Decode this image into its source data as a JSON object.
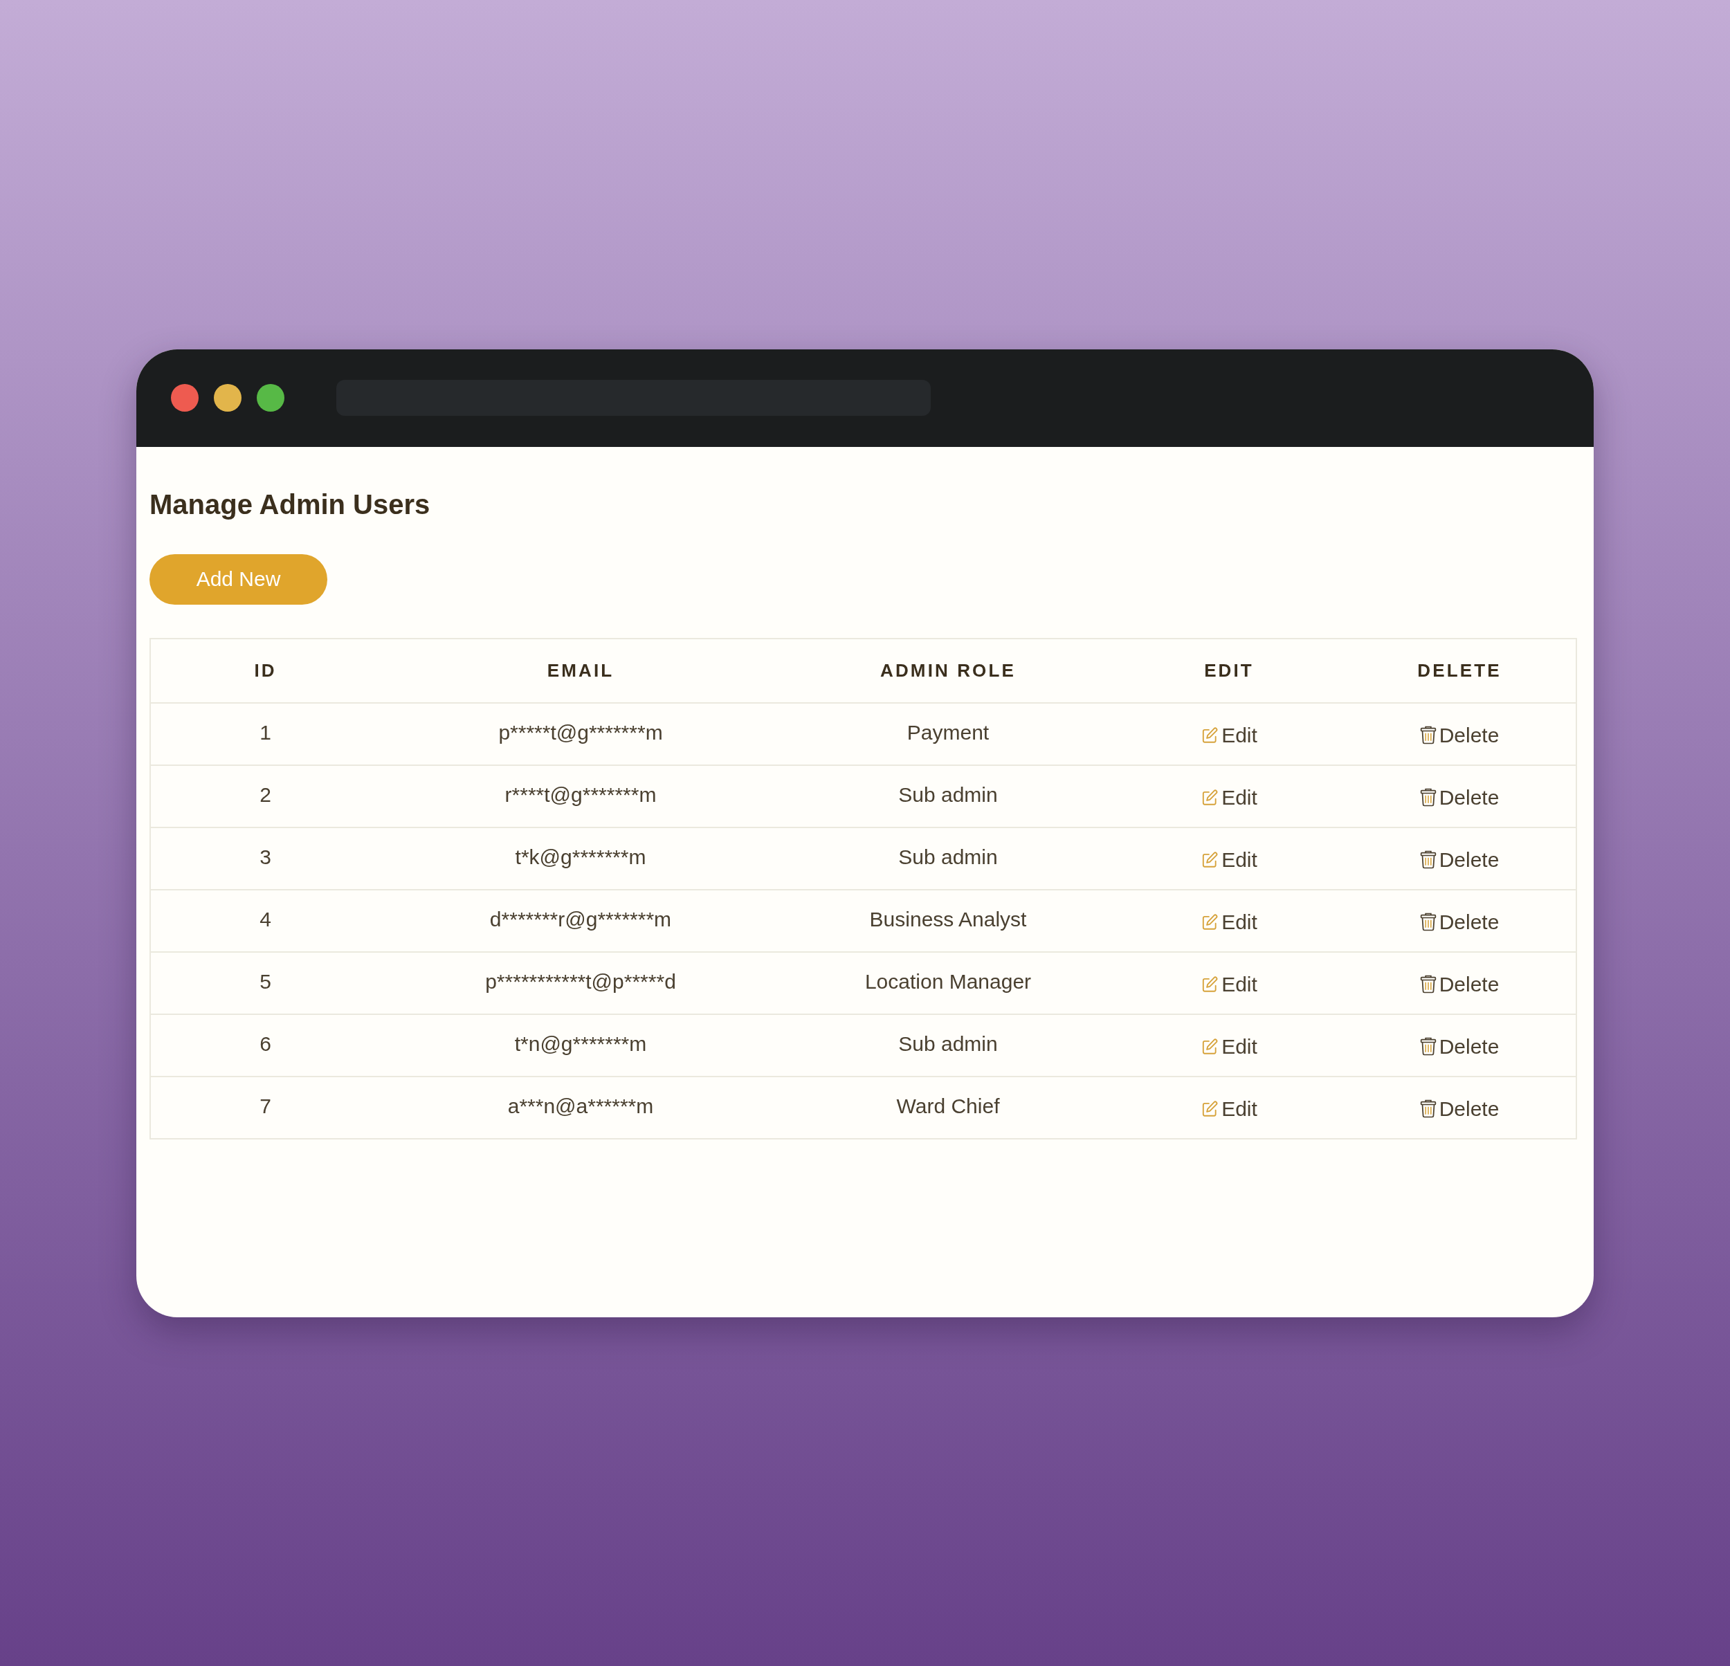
{
  "browser": {
    "window_controls": [
      {
        "color": "#ee5b50"
      },
      {
        "color": "#e2b54b"
      },
      {
        "color": "#57b946"
      }
    ]
  },
  "page": {
    "title": "Manage Admin Users",
    "add_button": "Add New"
  },
  "table": {
    "columns": [
      "ID",
      "EMAIL",
      "ADMIN ROLE",
      "EDIT",
      "DELETE"
    ],
    "rows": [
      {
        "id": "1",
        "email": "p*****t@g*******m",
        "role": "Payment",
        "edit": "Edit",
        "delete": "Delete"
      },
      {
        "id": "2",
        "email": "r****t@g*******m",
        "role": "Sub admin",
        "edit": "Edit",
        "delete": "Delete"
      },
      {
        "id": "3",
        "email": "t*k@g*******m",
        "role": "Sub admin",
        "edit": "Edit",
        "delete": "Delete"
      },
      {
        "id": "4",
        "email": "d*******r@g*******m",
        "role": "Business Analyst",
        "edit": "Edit",
        "delete": "Delete"
      },
      {
        "id": "5",
        "email": "p***********t@p*****d",
        "role": "Location Manager",
        "edit": "Edit",
        "delete": "Delete"
      },
      {
        "id": "6",
        "email": "t*n@g*******m",
        "role": "Sub admin",
        "edit": "Edit",
        "delete": "Delete"
      },
      {
        "id": "7",
        "email": "a***n@a******m",
        "role": "Ward Chief",
        "edit": "Edit",
        "delete": "Delete"
      }
    ]
  }
}
